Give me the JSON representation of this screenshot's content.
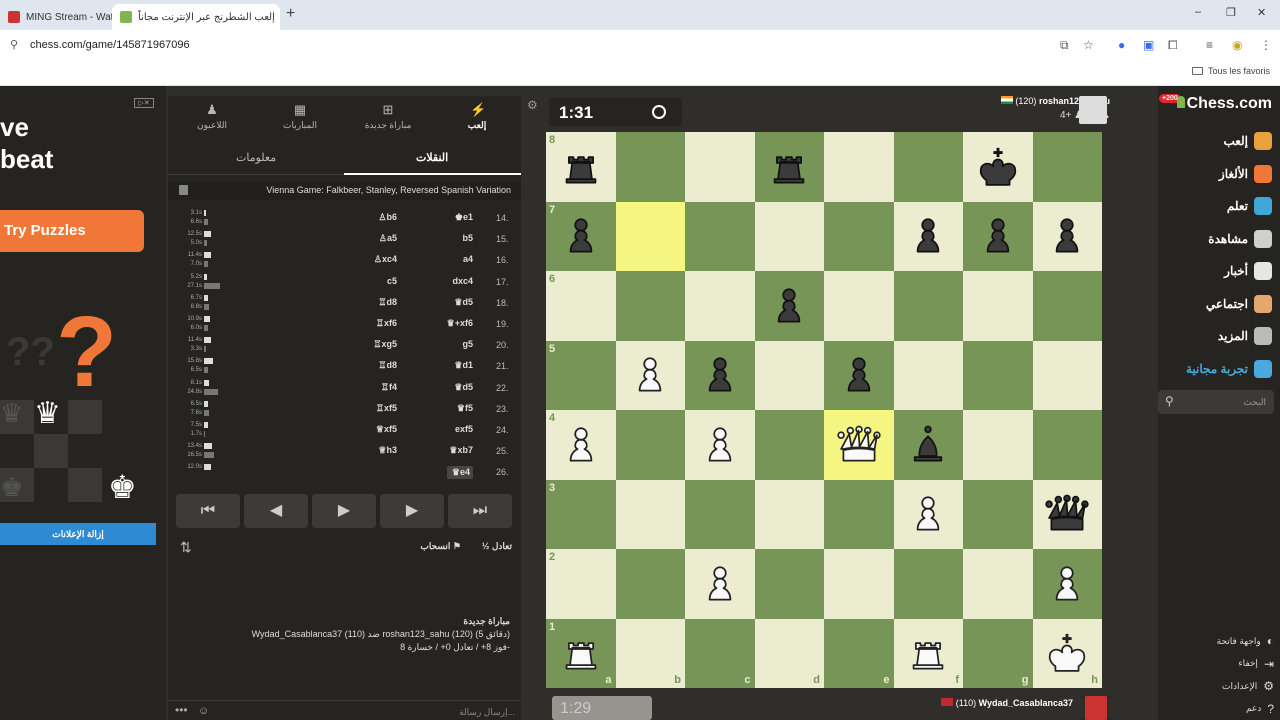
{
  "browser": {
    "tabs": [
      {
        "title": "MING Stream - Watch L",
        "active": false
      },
      {
        "title": "إلعب الشطرنج عبر الإنترنت مجاناً",
        "active": true
      }
    ],
    "new_tab": "+",
    "url": "chess.com/game/145871967096",
    "bookmarks_all": "Tous les favoris",
    "win_min": "–",
    "win_max": "❐",
    "win_close": "✕"
  },
  "ad": {
    "line1": "ve",
    "line2": "beat",
    "button": "Try Puzzles",
    "question_mark": "?",
    "faded_marks": "??",
    "remove_ads": "إزالة الإعلانات",
    "badge": "▷✕"
  },
  "panel": {
    "tabs": [
      {
        "label": "اللاعبون",
        "icon": "players-icon",
        "glyph": "♟"
      },
      {
        "label": "المباريات",
        "icon": "games-icon",
        "glyph": "▦"
      },
      {
        "label": "مباراة جديدة",
        "icon": "new-game-icon",
        "glyph": "⊞"
      },
      {
        "label": "إلعب",
        "icon": "play-icon",
        "glyph": "⚡"
      }
    ],
    "subtabs": {
      "info": "معلومات",
      "moves": "النقلات"
    },
    "opening": "Vienna Game: Falkbeer, Stanley, Reversed Spanish Variation",
    "moves": [
      {
        "num": "14.",
        "white": "e1",
        "white_piece": "♚",
        "black": "b6",
        "black_piece": "♙",
        "t_white": "3.1s",
        "t_black": "6.6s",
        "p_white": 0.06,
        "p_black": 0.12
      },
      {
        "num": "15.",
        "white": "b5",
        "white_piece": "",
        "black": "a5",
        "black_piece": "♙",
        "t_white": "12.5s",
        "t_black": "5.0s",
        "p_white": 0.24,
        "p_black": 0.1
      },
      {
        "num": "16.",
        "white": "a4",
        "white_piece": "",
        "black": "xc4",
        "black_piece": "♙",
        "t_white": "11.4s",
        "t_black": "7.0s",
        "p_white": 0.22,
        "p_black": 0.13
      },
      {
        "num": "17.",
        "white": "dxc4",
        "white_piece": "",
        "black": "c5",
        "black_piece": "",
        "t_white": "5.2s",
        "t_black": "27.1s",
        "p_white": 0.1,
        "p_black": 0.52
      },
      {
        "num": "18.",
        "white": "d5",
        "white_piece": "♛",
        "black": "d8",
        "black_piece": "♖",
        "t_white": "6.7s",
        "t_black": "8.8s",
        "p_white": 0.13,
        "p_black": 0.17
      },
      {
        "num": "19.",
        "white": "+xf6",
        "white_piece": "♛",
        "black": "xf6",
        "black_piece": "♖",
        "t_white": "10.9s",
        "t_black": "6.0s",
        "p_white": 0.21,
        "p_black": 0.12
      },
      {
        "num": "20.",
        "white": "g5",
        "white_piece": "",
        "black": "xg5",
        "black_piece": "♖",
        "t_white": "11.4s",
        "t_black": "3.3s",
        "p_white": 0.22,
        "p_black": 0.06
      },
      {
        "num": "21.",
        "white": "d1",
        "white_piece": "♛",
        "black": "d8",
        "black_piece": "♖",
        "t_white": "15.8s",
        "t_black": "6.5s",
        "p_white": 0.3,
        "p_black": 0.12
      },
      {
        "num": "22.",
        "white": "d5",
        "white_piece": "♛",
        "black": "f4",
        "black_piece": "♖",
        "t_white": "8.1s",
        "t_black": "24.8s",
        "p_white": 0.16,
        "p_black": 0.48
      },
      {
        "num": "23.",
        "white": "f5",
        "white_piece": "♛",
        "black": "xf5",
        "black_piece": "♖",
        "t_white": "6.5s",
        "t_black": "7.6s",
        "p_white": 0.12,
        "p_black": 0.15
      },
      {
        "num": "24.",
        "white": "exf5",
        "white_piece": "",
        "black": "xf5",
        "black_piece": "♕",
        "t_white": "7.5s",
        "t_black": "1.7s",
        "p_white": 0.14,
        "p_black": 0.03
      },
      {
        "num": "25.",
        "white": "xb7",
        "white_piece": "♛",
        "black": "h3",
        "black_piece": "♕",
        "t_white": "13.4s",
        "t_black": "16.5s",
        "p_white": 0.26,
        "p_black": 0.32
      },
      {
        "num": "26.",
        "white": "e4",
        "white_piece": "♛",
        "black": "",
        "black_piece": "",
        "t_white": "12.0s",
        "t_black": "",
        "p_white": 0.23,
        "p_black": 0,
        "current": true
      }
    ],
    "controls": [
      "⏮",
      "◀",
      "▶",
      "▶",
      "⏭"
    ],
    "flip": "⇅",
    "resign": "انسحاب",
    "draw": "½ تعادل",
    "chat_title": "مباراة جديدة",
    "chat_line1": "Wydad_Casablanca37 (110) ضد roshan123_sahu (120) (5 دقائق)",
    "chat_line2": "فوز 8+ / تعادل 0+ / خسارة 8-",
    "chat_placeholder": "إرسال رسالة...",
    "chat_emoji": "☺",
    "chat_more": "•••"
  },
  "game": {
    "top_clock": "1:31",
    "bottom_clock": "1:29",
    "opponent": {
      "name": "roshan123_sahu",
      "rating": "(120)",
      "captured": "4+"
    },
    "me": {
      "name": "Wydad_Casablanca37",
      "rating": "(110)"
    },
    "files": [
      "a",
      "b",
      "c",
      "d",
      "e",
      "f",
      "g",
      "h"
    ],
    "ranks": [
      "8",
      "7",
      "6",
      "5",
      "4",
      "3",
      "2",
      "1"
    ],
    "highlight_squares": [
      "b7",
      "e4"
    ],
    "pieces": [
      {
        "sq": "a8",
        "type": "rook",
        "color": "black"
      },
      {
        "sq": "d8",
        "type": "rook",
        "color": "black"
      },
      {
        "sq": "g8",
        "type": "king",
        "color": "black"
      },
      {
        "sq": "a7",
        "type": "pawn",
        "color": "black"
      },
      {
        "sq": "f7",
        "type": "pawn",
        "color": "black"
      },
      {
        "sq": "g7",
        "type": "pawn",
        "color": "black"
      },
      {
        "sq": "h7",
        "type": "pawn",
        "color": "black"
      },
      {
        "sq": "d6",
        "type": "pawn",
        "color": "black"
      },
      {
        "sq": "b5",
        "type": "pawn",
        "color": "white"
      },
      {
        "sq": "c5",
        "type": "pawn",
        "color": "black"
      },
      {
        "sq": "e5",
        "type": "pawn",
        "color": "black"
      },
      {
        "sq": "a4",
        "type": "pawn",
        "color": "white"
      },
      {
        "sq": "c4",
        "type": "pawn",
        "color": "white"
      },
      {
        "sq": "e4",
        "type": "queen",
        "color": "white"
      },
      {
        "sq": "f4",
        "type": "bishop",
        "color": "black"
      },
      {
        "sq": "f3",
        "type": "pawn",
        "color": "white"
      },
      {
        "sq": "h3",
        "type": "queen",
        "color": "black"
      },
      {
        "sq": "c2",
        "type": "pawn",
        "color": "white"
      },
      {
        "sq": "h2",
        "type": "pawn",
        "color": "white"
      },
      {
        "sq": "a1",
        "type": "rook",
        "color": "white"
      },
      {
        "sq": "f1",
        "type": "rook",
        "color": "white"
      },
      {
        "sq": "h1",
        "type": "king",
        "color": "white"
      }
    ]
  },
  "nav": {
    "logo": "Chess.com",
    "promo": "+200",
    "items": [
      {
        "label": "إلعب",
        "color": "#e8a13c"
      },
      {
        "label": "الألغاز",
        "color": "#f07737"
      },
      {
        "label": "تعلم",
        "color": "#3fa6d8"
      },
      {
        "label": "مشاهدة",
        "color": "#cfcfcf"
      },
      {
        "label": "أخبار",
        "color": "#e6e6e6"
      },
      {
        "label": "اجتماعي",
        "color": "#e3a76f"
      },
      {
        "label": "المزيد",
        "color": "#bbbbbb"
      },
      {
        "label": "تجربة مجانية",
        "color": "#4aa8e0"
      }
    ],
    "search_placeholder": "البحث",
    "bottom": [
      {
        "label": "واجهة فاتحة",
        "glyph": "◐"
      },
      {
        "label": "إخفاء",
        "glyph": "⇥"
      },
      {
        "label": "الإعدادات",
        "glyph": "⚙"
      },
      {
        "label": "دعم",
        "glyph": "?"
      }
    ]
  }
}
